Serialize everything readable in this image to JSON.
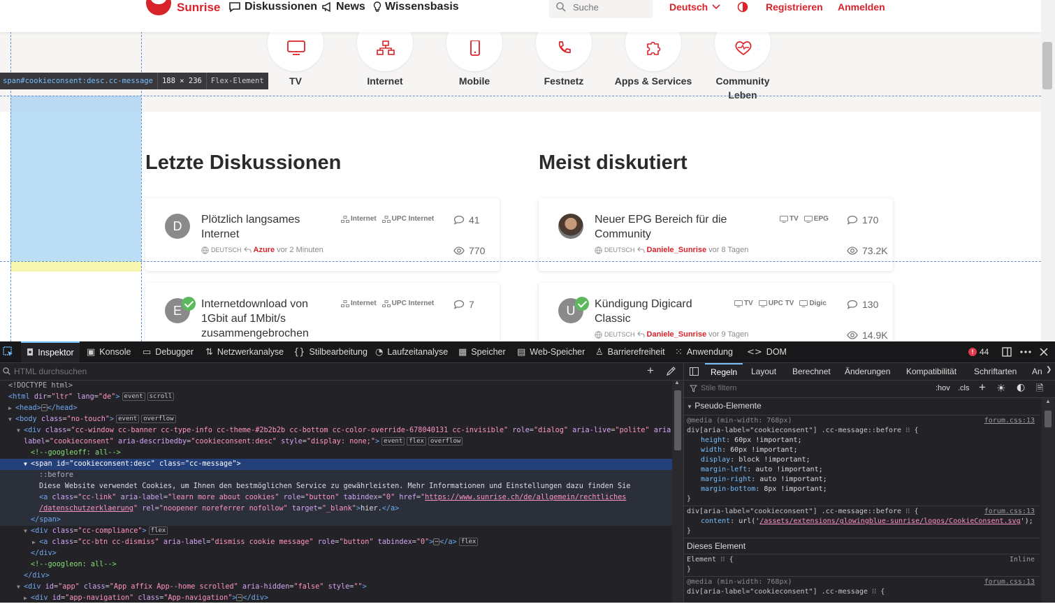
{
  "site": {
    "brand": "Sunrise",
    "nav": [
      {
        "label": "Diskussionen",
        "icon": "chat-icon"
      },
      {
        "label": "News",
        "icon": "megaphone-icon"
      },
      {
        "label": "Wissensbasis",
        "icon": "lightbulb-icon"
      }
    ],
    "search_placeholder": "Suche",
    "language": "Deutsch",
    "register": "Registrieren",
    "login": "Anmelden",
    "categories": [
      {
        "label": "TV",
        "icon": "tv-icon"
      },
      {
        "label": "Internet",
        "icon": "network-icon"
      },
      {
        "label": "Mobile",
        "icon": "mobile-icon"
      },
      {
        "label": "Festnetz",
        "icon": "phone-icon"
      },
      {
        "label": "Apps & Services",
        "icon": "puzzle-icon"
      },
      {
        "label": "Community Leben",
        "icon": "heart-pulse-icon"
      }
    ],
    "left_title": "Letzte Diskussionen",
    "right_title": "Meist diskutiert",
    "left_cards": [
      {
        "avatar": "D",
        "title": "Plötzlich langsames Internet",
        "tags": [
          "Internet",
          "UPC Internet"
        ],
        "lang": "DEUTSCH",
        "user": "Azure",
        "time": "vor 2 Minuten",
        "replies": "41",
        "views": "770"
      },
      {
        "avatar": "E",
        "title": "Internetdownload von 1Gbit auf 1Mbit/s zusammengebrochen",
        "tags": [
          "Internet",
          "UPC Internet"
        ],
        "replies": "7"
      }
    ],
    "right_cards": [
      {
        "avatar": "",
        "title": "Neuer EPG Bereich für die Community",
        "tags": [
          "TV",
          "EPG"
        ],
        "lang": "DEUTSCH",
        "user": "Daniele_Sunrise",
        "time": "vor 8 Tagen",
        "replies": "170",
        "views": "73.2K"
      },
      {
        "avatar": "U",
        "title": "Kündigung Digicard Classic",
        "tags": [
          "TV",
          "UPC TV",
          "Digic"
        ],
        "lang": "DEUTSCH",
        "user": "Daniele_Sunrise",
        "time": "vor 9 Tagen",
        "replies": "130",
        "views": "14.9K"
      }
    ],
    "brand_color": "#d8232a"
  },
  "inspector_tip": {
    "selector": "span#cookieconsent:desc.cc-message",
    "size": "188 × 236",
    "kind": "Flex-Element"
  },
  "devtools": {
    "tabs": [
      "Inspektor",
      "Konsole",
      "Debugger",
      "Netzwerkanalyse",
      "Stilbearbeitung",
      "Laufzeitanalyse",
      "Speicher",
      "Web-Speicher",
      "Barrierefreiheit",
      "Anwendung",
      "DOM"
    ],
    "error_count": "44",
    "html_search_placeholder": "HTML durchsuchen",
    "rules_tabs": [
      "Regeln",
      "Layout",
      "Berechnet",
      "Änderungen",
      "Kompatibilität",
      "Schriftarten",
      "An"
    ],
    "styles_filter_placeholder": "Stile filtern",
    "hov": ":hov",
    "cls": ".cls",
    "pseudo_header": "Pseudo-Elemente",
    "element_header": "Dieses Element",
    "element_rule": "Element",
    "inline": "Inline",
    "css_source": "forum.css:13",
    "media": "@media (min-width: 768px)",
    "selector_before": "div[aria-label=\"cookieconsent\"] .cc-message::before",
    "selector_msg": "div[aria-label=\"cookieconsent\"] .cc-message",
    "props1": [
      [
        "height",
        "60px !important;"
      ],
      [
        "width",
        "60px !important;"
      ],
      [
        "display",
        "block !important;"
      ],
      [
        "margin-left",
        "auto !important;"
      ],
      [
        "margin-right",
        "auto !important;"
      ],
      [
        "margin-bottom",
        "8px !important;"
      ]
    ],
    "content_prop": "content",
    "content_val": "/assets/extensions/glowingblue-sunrise/logos/CookieConsent.svg",
    "tree": {
      "doctype": "<!DOCTYPE html>",
      "cookie_text": "Diese Website verwendet Cookies, um Ihnen den bestmöglichen Service zu gewährleisten. Mehr Informationen und Einstellungen dazu finden Sie",
      "link_href": "https://www.sunrise.ch/de/allgemein/rechtliches",
      "link_href2": "/datenschutzerklaerung",
      "link_text": "hier.",
      "googleoff": "<!--googleoff: all-->",
      "googleon": "<!--googleon: all-->"
    }
  }
}
